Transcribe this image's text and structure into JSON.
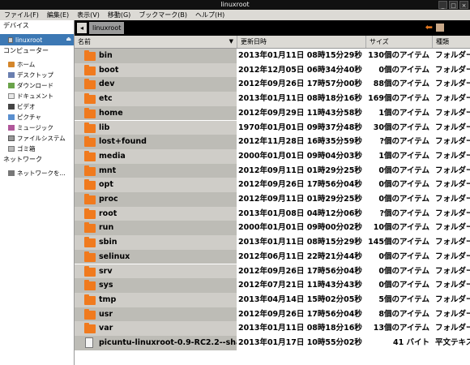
{
  "window": {
    "title": "linuxroot"
  },
  "menubar": [
    {
      "label": "ファイル(F)"
    },
    {
      "label": "編集(E)"
    },
    {
      "label": "表示(V)"
    },
    {
      "label": "移動(G)"
    },
    {
      "label": "ブックマーク(B)"
    },
    {
      "label": "ヘルプ(H)"
    }
  ],
  "sidebar": {
    "devices_heading": "デバイス",
    "device": "linuxroot",
    "computer_heading": "コンピューター",
    "places": [
      {
        "label": "ホーム",
        "icon": "home-icon"
      },
      {
        "label": "デスクトップ",
        "icon": "desktop-icon"
      },
      {
        "label": "ダウンロード",
        "icon": "download-icon"
      },
      {
        "label": "ドキュメント",
        "icon": "document-icon"
      },
      {
        "label": "ビデオ",
        "icon": "video-icon"
      },
      {
        "label": "ピクチャ",
        "icon": "picture-icon"
      },
      {
        "label": "ミュージック",
        "icon": "music-icon"
      },
      {
        "label": "ファイルシステム",
        "icon": "filesystem-icon"
      },
      {
        "label": "ゴミ箱",
        "icon": "trash-icon"
      }
    ],
    "network_heading": "ネットワーク",
    "network_item": "ネットワークを..."
  },
  "pathbar": {
    "current": "linuxroot"
  },
  "columns": {
    "name": "名前",
    "date": "更新日時",
    "size": "サイズ",
    "type": "種類"
  },
  "files": [
    {
      "name": "bin",
      "date": "2013年01月11日 08時15分29秒",
      "size": "130個のアイテム",
      "type": "フォルダー",
      "kind": "folder"
    },
    {
      "name": "boot",
      "date": "2012年12月05日 06時34分40秒",
      "size": "0個のアイテム",
      "type": "フォルダー",
      "kind": "folder"
    },
    {
      "name": "dev",
      "date": "2012年09月26日 17時57分00秒",
      "size": "88個のアイテム",
      "type": "フォルダー",
      "kind": "folder"
    },
    {
      "name": "etc",
      "date": "2013年01月11日 08時18分16秒",
      "size": "169個のアイテム",
      "type": "フォルダー",
      "kind": "folder"
    },
    {
      "name": "home",
      "date": "2012年09月29日 11時43分58秒",
      "size": "1個のアイテム",
      "type": "フォルダー",
      "kind": "folder"
    },
    {
      "name": "lib",
      "date": "1970年01月01日 09時37分48秒",
      "size": "30個のアイテム",
      "type": "フォルダー",
      "kind": "folder"
    },
    {
      "name": "lost+found",
      "date": "2012年11月28日 16時35分59秒",
      "size": "?個のアイテム",
      "type": "フォルダー",
      "kind": "folder"
    },
    {
      "name": "media",
      "date": "2000年01月01日 09時04分03秒",
      "size": "1個のアイテム",
      "type": "フォルダー",
      "kind": "folder"
    },
    {
      "name": "mnt",
      "date": "2012年09月11日 01時29分25秒",
      "size": "0個のアイテム",
      "type": "フォルダー",
      "kind": "folder"
    },
    {
      "name": "opt",
      "date": "2012年09月26日 17時56分04秒",
      "size": "0個のアイテム",
      "type": "フォルダー",
      "kind": "folder"
    },
    {
      "name": "proc",
      "date": "2012年09月11日 01時29分25秒",
      "size": "0個のアイテム",
      "type": "フォルダー",
      "kind": "folder"
    },
    {
      "name": "root",
      "date": "2013年01月08日 04時12分06秒",
      "size": "?個のアイテム",
      "type": "フォルダー",
      "kind": "folder"
    },
    {
      "name": "run",
      "date": "2000年01月01日 09時00分02秒",
      "size": "10個のアイテム",
      "type": "フォルダー",
      "kind": "folder"
    },
    {
      "name": "sbin",
      "date": "2013年01月11日 08時15分29秒",
      "size": "145個のアイテム",
      "type": "フォルダー",
      "kind": "folder"
    },
    {
      "name": "selinux",
      "date": "2012年06月11日 22時21分44秒",
      "size": "0個のアイテム",
      "type": "フォルダー",
      "kind": "folder"
    },
    {
      "name": "srv",
      "date": "2012年09月26日 17時56分04秒",
      "size": "0個のアイテム",
      "type": "フォルダー",
      "kind": "folder"
    },
    {
      "name": "sys",
      "date": "2012年07月21日 11時43分43秒",
      "size": "0個のアイテム",
      "type": "フォルダー",
      "kind": "folder"
    },
    {
      "name": "tmp",
      "date": "2013年04月14日 15時02分05秒",
      "size": "5個のアイテム",
      "type": "フォルダー",
      "kind": "folder"
    },
    {
      "name": "usr",
      "date": "2012年09月26日 17時56分04秒",
      "size": "8個のアイテム",
      "type": "フォルダー",
      "kind": "folder"
    },
    {
      "name": "var",
      "date": "2013年01月11日 08時18分16秒",
      "size": "13個のアイテム",
      "type": "フォルダー",
      "kind": "folder"
    },
    {
      "name": "picuntu-linuxroot-0.9-RC2.2--sha",
      "date": "2013年01月17日 10時55分02秒",
      "size": "41 バイト",
      "type": "平文テキス",
      "kind": "file"
    }
  ]
}
